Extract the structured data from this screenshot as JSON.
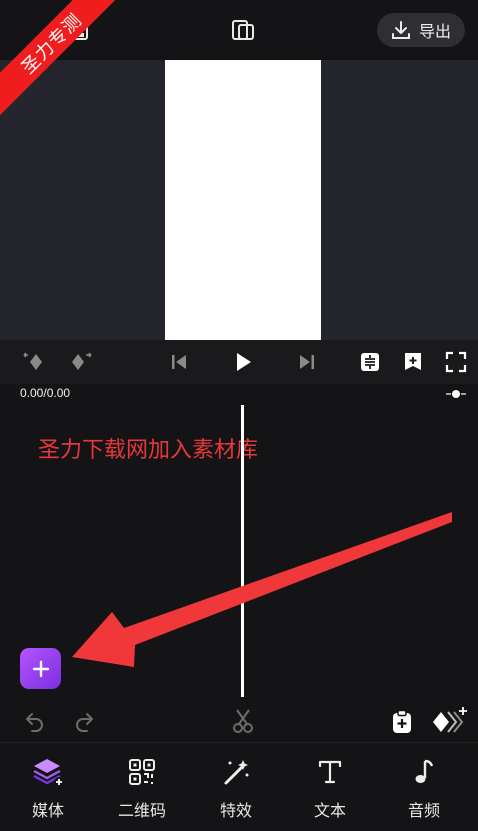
{
  "header": {
    "export_label": "导出"
  },
  "watermark": {
    "text": "圣力专测"
  },
  "timeline": {
    "time": "0.00/0.00",
    "annotation": "圣力下载网加入素材库"
  },
  "toolbar": {
    "items": [
      {
        "label": "媒体",
        "icon": "media-layers-icon"
      },
      {
        "label": "二维码",
        "icon": "qr-code-icon"
      },
      {
        "label": "特效",
        "icon": "magic-wand-icon"
      },
      {
        "label": "文本",
        "icon": "text-icon"
      },
      {
        "label": "音频",
        "icon": "music-note-icon"
      }
    ]
  },
  "colors": {
    "accent": "#9b3ff0",
    "annotation_red": "#e8373a",
    "arrow_red": "#f0383a"
  }
}
